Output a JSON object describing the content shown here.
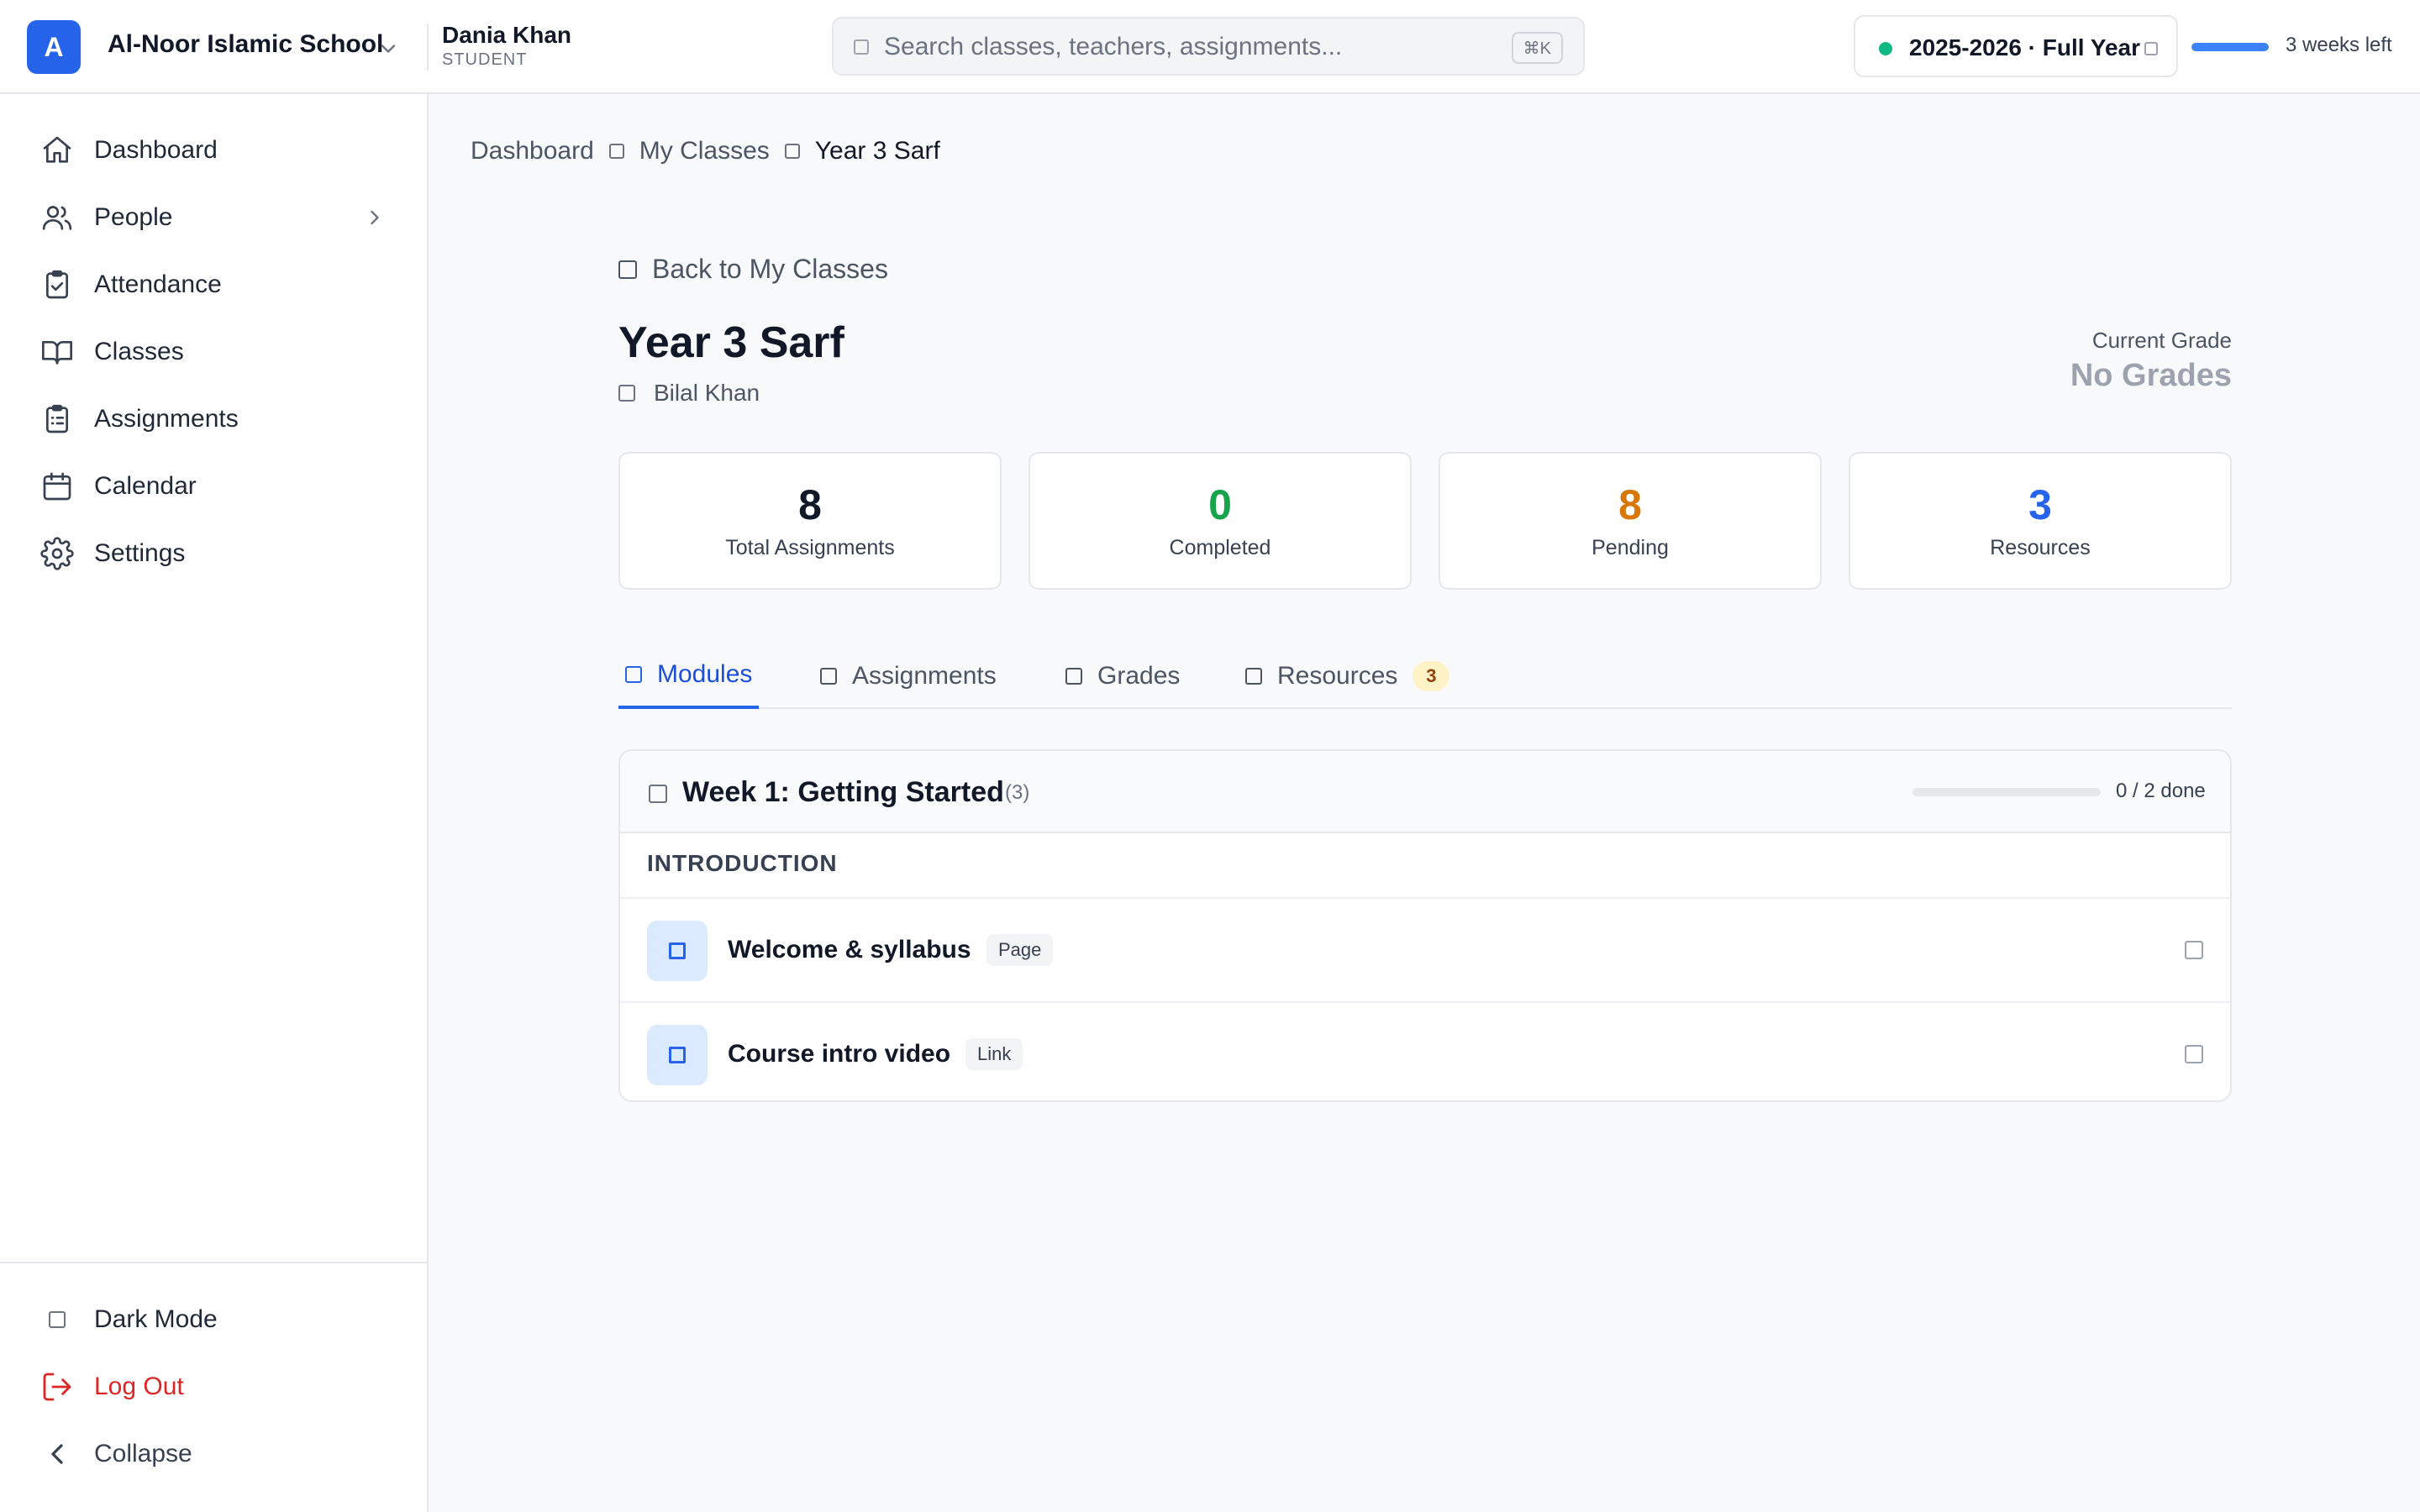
{
  "topbar": {
    "logo_letter": "A",
    "school_name": "Al-Noor Islamic School",
    "user_name": "Dania Khan",
    "user_role": "STUDENT",
    "search_placeholder": "Search classes, teachers, assignments...",
    "search_shortcut": "⌘K",
    "term_label": "2025-2026 · Full Year",
    "term_progress_percent": 100,
    "term_remaining": "3 weeks left"
  },
  "sidebar": {
    "items": [
      {
        "label": "Dashboard"
      },
      {
        "label": "People"
      },
      {
        "label": "Attendance"
      },
      {
        "label": "Classes"
      },
      {
        "label": "Assignments"
      },
      {
        "label": "Calendar"
      },
      {
        "label": "Settings"
      }
    ],
    "bottom": {
      "dark_mode": "Dark Mode",
      "logout": "Log Out",
      "collapse": "Collapse"
    }
  },
  "breadcrumb": [
    "Dashboard",
    "My Classes",
    "Year 3 Sarf"
  ],
  "class_page": {
    "back_label": "Back to My Classes",
    "title": "Year 3 Sarf",
    "teacher": "Bilal Khan",
    "grade_label": "Current Grade",
    "grade_value": "No Grades"
  },
  "stats": [
    {
      "value": "8",
      "label": "Total Assignments",
      "color": "#111827"
    },
    {
      "value": "0",
      "label": "Completed",
      "color": "#16a34a"
    },
    {
      "value": "8",
      "label": "Pending",
      "color": "#d97706"
    },
    {
      "value": "3",
      "label": "Resources",
      "color": "#2563eb"
    }
  ],
  "tabs": [
    {
      "label": "Modules"
    },
    {
      "label": "Assignments"
    },
    {
      "label": "Grades"
    },
    {
      "label": "Resources",
      "badge": "3"
    }
  ],
  "module": {
    "title": "Week 1: Getting Started",
    "count": "(3)",
    "progress_percent": 0,
    "done_text": "0 / 2 done",
    "section": "INTRODUCTION",
    "items": [
      {
        "title": "Welcome & syllabus",
        "tag": "Page"
      },
      {
        "title": "Course intro video",
        "tag": "Link"
      }
    ]
  },
  "colors": {
    "brand": "#2563eb",
    "logout": "#dc2626",
    "term_dot": "#10b981"
  }
}
